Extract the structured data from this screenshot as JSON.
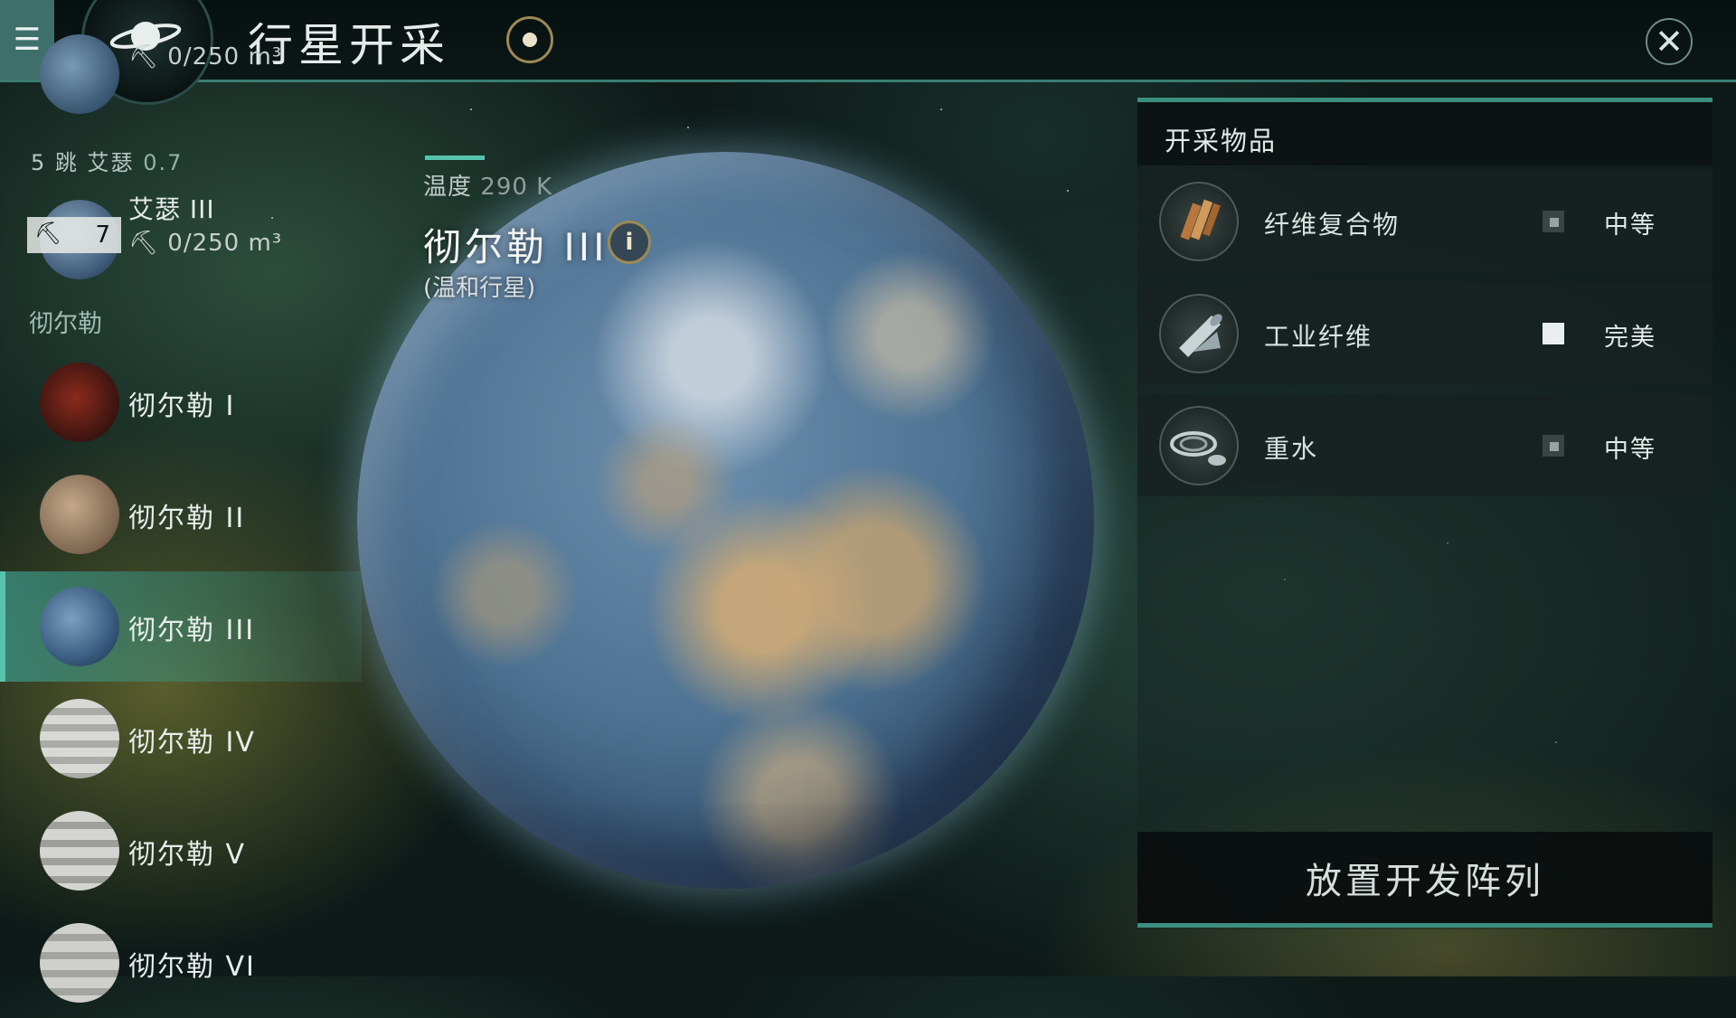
{
  "header": {
    "title": "行星开采",
    "menu_icon": "hamburger-menu-icon",
    "emblem_icon": "planet-ring-icon",
    "target_icon": "target-icon",
    "close_icon": "close-icon"
  },
  "sidebar": {
    "top_partial": {
      "capacity": "0/250 m³"
    },
    "system_1": {
      "jumps": "5 跳",
      "name": "艾瑟",
      "security": "0.7"
    },
    "aisse_iii": {
      "label": "艾瑟 III",
      "badge": "7",
      "capacity": "0/250 m³"
    },
    "system_2_label": "彻尔勒",
    "planets": [
      {
        "label": "彻尔勒 I"
      },
      {
        "label": "彻尔勒 II"
      },
      {
        "label": "彻尔勒 III"
      },
      {
        "label": "彻尔勒 IV"
      },
      {
        "label": "彻尔勒 V"
      },
      {
        "label": "彻尔勒 VI"
      }
    ],
    "selected": "彻尔勒 III"
  },
  "planet": {
    "temp_label": "温度",
    "temp_value": "290 K",
    "name": "彻尔勒 III",
    "type": "(温和行星)"
  },
  "panel": {
    "title": "开采物品",
    "items": [
      {
        "name": "纤维复合物",
        "quality": "中等",
        "icon": "fiber-composite-icon"
      },
      {
        "name": "工业纤维",
        "quality": "完美",
        "icon": "industrial-fiber-icon"
      },
      {
        "name": "重水",
        "quality": "中等",
        "icon": "heavy-water-icon"
      }
    ],
    "deploy_label": "放置开发阵列"
  },
  "colors": {
    "accent": "#56c3ae",
    "gold": "#9b8a55"
  }
}
